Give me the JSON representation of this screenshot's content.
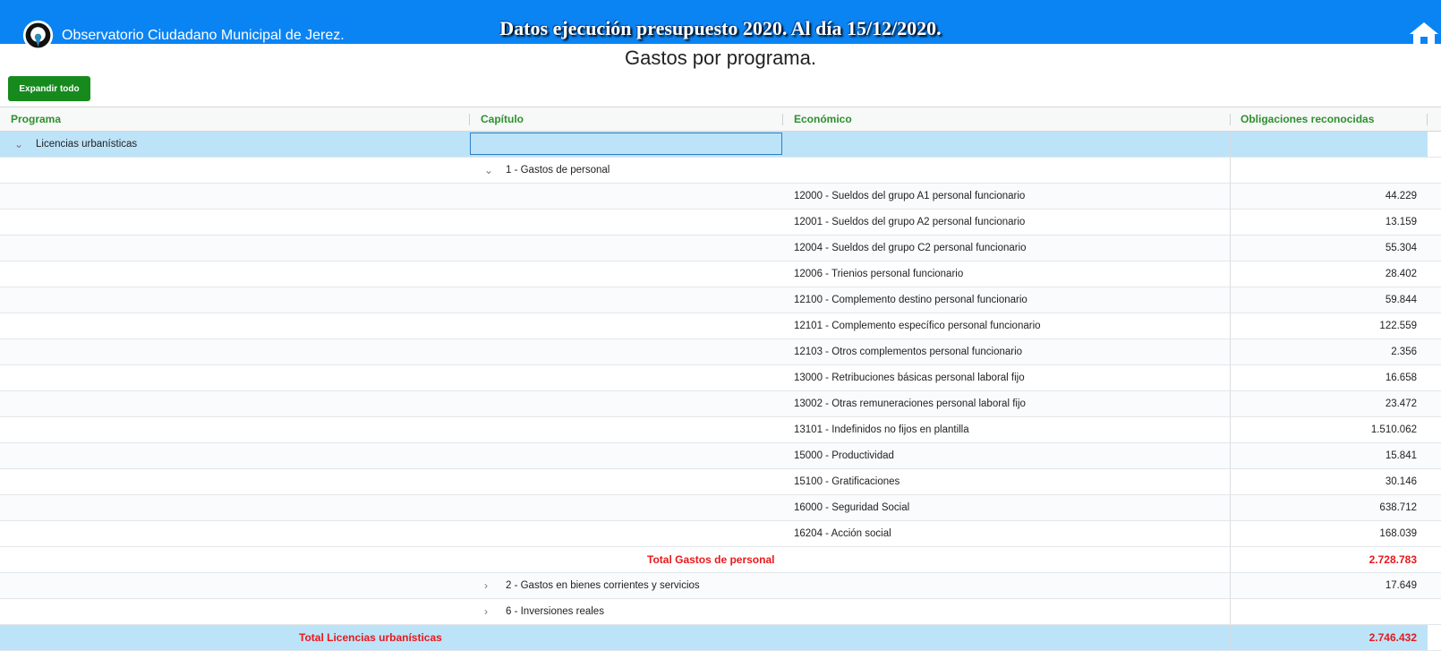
{
  "header": {
    "brand": "Observatorio Ciudadano Municipal de Jerez.",
    "title": "Datos ejecución presupuesto 2020. Al día 15/12/2020.",
    "subtitle": "Gastos por programa."
  },
  "toolbar": {
    "expand_label": "Expandir todo"
  },
  "columns": [
    "Programa",
    "Capítulo",
    "Económico",
    "Obligaciones reconocidas"
  ],
  "program": {
    "label": "Licencias urbanísticas",
    "total_label": "Total Licencias urbanísticas",
    "total_value": "2.746.432"
  },
  "chapter1": {
    "label": "1 - Gastos de personal",
    "total_label": "Total Gastos de personal",
    "total_value": "2.728.783"
  },
  "economic": [
    {
      "label": "12000 - Sueldos del grupo A1 personal funcionario",
      "value": "44.229"
    },
    {
      "label": "12001 - Sueldos del grupo A2 personal funcionario",
      "value": "13.159"
    },
    {
      "label": "12004 - Sueldos del grupo C2 personal funcionario",
      "value": "55.304"
    },
    {
      "label": "12006 - Trienios personal funcionario",
      "value": "28.402"
    },
    {
      "label": "12100 - Complemento destino personal funcionario",
      "value": "59.844"
    },
    {
      "label": "12101 - Complemento específico personal funcionario",
      "value": "122.559"
    },
    {
      "label": "12103 - Otros complementos personal funcionario",
      "value": "2.356"
    },
    {
      "label": "13000 - Retribuciones básicas personal laboral fijo",
      "value": "16.658"
    },
    {
      "label": "13002 - Otras remuneraciones personal laboral fijo",
      "value": "23.472"
    },
    {
      "label": "13101 - Indefinidos no fijos en plantilla",
      "value": "1.510.062"
    },
    {
      "label": "15000 - Productividad",
      "value": "15.841"
    },
    {
      "label": "15100 - Gratificaciones",
      "value": "30.146"
    },
    {
      "label": "16000 - Seguridad Social",
      "value": "638.712"
    },
    {
      "label": "16204 - Acción social",
      "value": "168.039"
    }
  ],
  "chapters_collapsed": [
    {
      "label": "2 - Gastos en bienes corrientes y servicios",
      "value": "17.649"
    },
    {
      "label": "6 - Inversiones reales",
      "value": ""
    }
  ],
  "colors": {
    "topbar": "#0b84f3",
    "accent_green": "#178a1e",
    "total_red": "#e8181b",
    "highlight": "#bde3f8"
  }
}
